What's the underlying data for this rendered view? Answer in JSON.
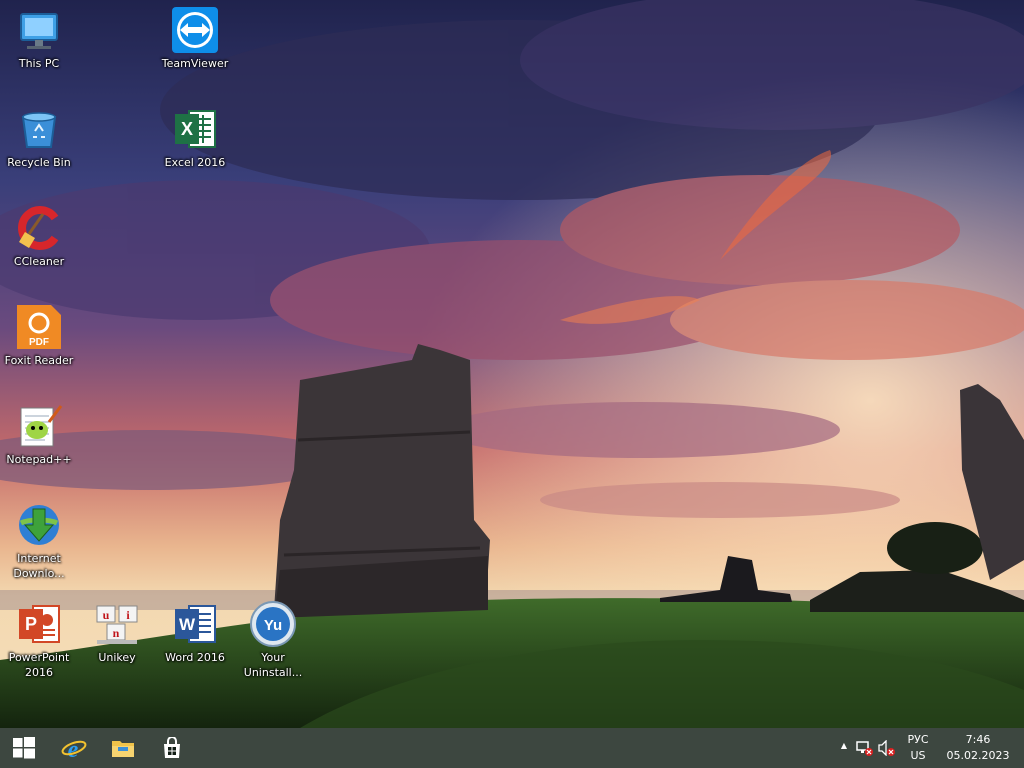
{
  "desktop": {
    "icons": [
      {
        "label": "This PC",
        "icon": "this-pc-icon"
      },
      {
        "label": "TeamViewer",
        "icon": "teamviewer-icon"
      },
      {
        "label": "Recycle Bin",
        "icon": "recycle-bin-icon"
      },
      {
        "label": "Excel 2016",
        "icon": "excel-icon"
      },
      {
        "label": "CCleaner",
        "icon": "ccleaner-icon"
      },
      {
        "label": "Foxit Reader",
        "icon": "foxit-reader-icon"
      },
      {
        "label": "Notepad++",
        "icon": "notepadpp-icon"
      },
      {
        "label": "Internet Downlo...",
        "icon": "internet-download-manager-icon"
      },
      {
        "label": "PowerPoint 2016",
        "icon": "powerpoint-icon"
      },
      {
        "label": "Unikey",
        "icon": "unikey-icon"
      },
      {
        "label": "Word 2016",
        "icon": "word-icon"
      },
      {
        "label": "Your Uninstall...",
        "icon": "your-uninstaller-icon"
      }
    ],
    "excel_letter": "X",
    "word_letter": "W",
    "powerpoint_letter": "P",
    "foxit_text": "PDF",
    "uninstaller_text": "Yu",
    "unikey_letters": [
      "u",
      "i",
      "n"
    ]
  },
  "taskbar": {
    "pinned": [
      {
        "name": "start",
        "icon": "windows-logo-icon"
      },
      {
        "name": "internet-explorer",
        "icon": "internet-explorer-icon"
      },
      {
        "name": "file-explorer",
        "icon": "file-explorer-icon"
      },
      {
        "name": "store",
        "icon": "store-icon"
      }
    ],
    "ie_letter": "e",
    "tray": {
      "show_hidden": "▲",
      "language": "РУС",
      "layout": "US",
      "time": "7:46",
      "date": "05.02.2023"
    }
  },
  "colors": {
    "taskbar_bg": "#121e16",
    "excel": "#1e7145",
    "word": "#2b579a",
    "powerpoint": "#d24726",
    "foxit": "#f08a24",
    "teamviewer": "#0e8ee9"
  }
}
